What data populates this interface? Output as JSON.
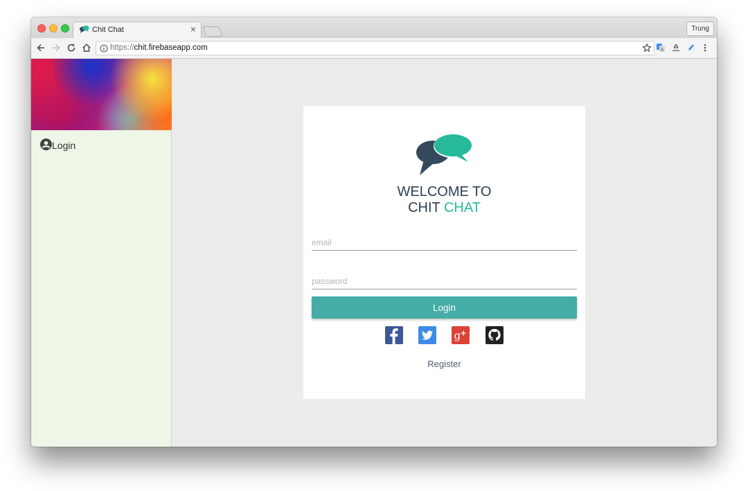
{
  "browser": {
    "tab_title": "Chit Chat",
    "tab_close": "×",
    "profile_name": "Trung",
    "url_scheme": "https://",
    "url_host": "chit.firebaseapp.com"
  },
  "sidebar": {
    "login_label": "Login"
  },
  "card": {
    "welcome_line1": "WELCOME TO",
    "welcome_line2_a": "CHIT",
    "welcome_line2_b": "CHAT",
    "email_placeholder": "email",
    "password_placeholder": "password",
    "login_button": "Login",
    "register_link": "Register"
  },
  "colors": {
    "accent": "#26b99a",
    "login_button": "#45aca6",
    "sidebar_bg": "#eef6e7",
    "facebook": "#3b5998",
    "twitter": "#3d8be5",
    "google_plus": "#dc4235",
    "github": "#222222"
  },
  "icons": {
    "social": [
      "facebook-icon",
      "twitter-icon",
      "google-plus-icon",
      "github-icon"
    ],
    "toolbar": [
      "back-icon",
      "forward-icon",
      "reload-icon",
      "home-icon",
      "info-icon",
      "star-icon",
      "translate-icon",
      "recycle-icon",
      "pencil-icon",
      "menu-icon"
    ]
  }
}
